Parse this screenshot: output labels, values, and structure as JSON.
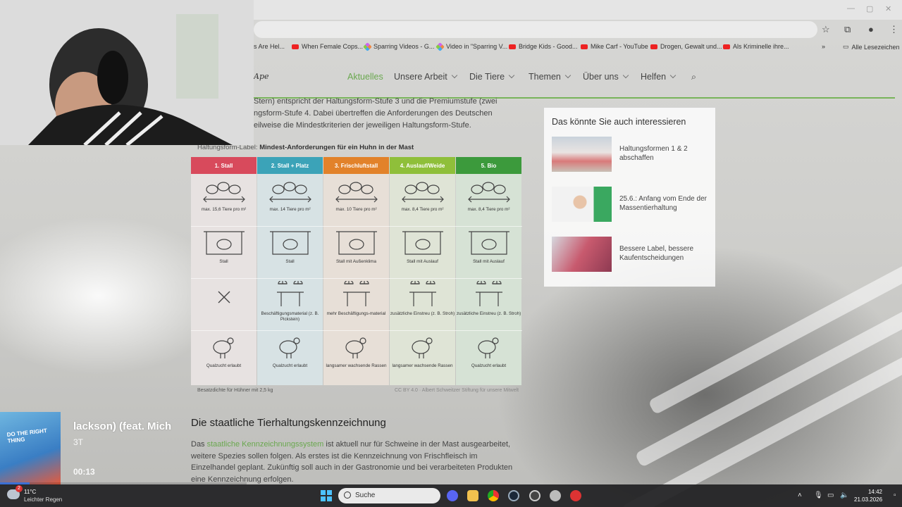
{
  "browser": {
    "bookmarks": [
      {
        "label": "s Are Hel...",
        "icon": "none"
      },
      {
        "label": "When Female Cops...",
        "icon": "youtube-icon"
      },
      {
        "label": "Sparring Videos - G...",
        "icon": "gemini-icon"
      },
      {
        "label": "Video in \"Sparring V...",
        "icon": "gemini-icon"
      },
      {
        "label": "Bridge Kids - Good...",
        "icon": "youtube-icon"
      },
      {
        "label": "Mike Carf - YouTube",
        "icon": "youtube-icon"
      },
      {
        "label": "Drogen, Gewalt und...",
        "icon": "youtube-icon"
      },
      {
        "label": "Als Kriminelle ihre...",
        "icon": "youtube-icon"
      }
    ],
    "bookmarks_more": "»",
    "all_bookmarks": "Alle Lesezeichen"
  },
  "site": {
    "logo": "Ape",
    "nav": [
      {
        "label": "Aktuelles",
        "active": true
      },
      {
        "label": "Unsere Arbeit",
        "dropdown": true
      },
      {
        "label": "Die Tiere",
        "dropdown": true
      },
      {
        "label": "Themen",
        "dropdown": true
      },
      {
        "label": "Über uns",
        "dropdown": true
      },
      {
        "label": "Helfen",
        "dropdown": true
      }
    ]
  },
  "article": {
    "intro": [
      "Stern) entspricht der Haltungsform-Stufe 3 und die Premiumstufe (zwei",
      "ngsform-Stufe 4. Dabei übertreffen die Anforderungen des Deutschen",
      "eilweise die Mindestkriterien der jeweiligen Haltungsform-Stufe."
    ],
    "figure_caption_prefix": "Haltungsform-Label: ",
    "figure_caption_bold": "Mindest-Anforderungen für ein Huhn in der Mast",
    "columns": [
      {
        "head": "1. Stall",
        "color": "#d84a5c",
        "bg": "#e7e2e1",
        "rows": [
          "max. 15,6 Tiere pro m²",
          "Stall",
          "",
          "Qualzucht erlaubt"
        ]
      },
      {
        "head": "2. Stall + Platz",
        "color": "#3ba3b8",
        "bg": "#d7e2e4",
        "rows": [
          "max. 14 Tiere pro m²",
          "Stall",
          "Beschäftigungsmaterial (z. B. Pickstein)",
          "Qualzucht erlaubt"
        ]
      },
      {
        "head": "3. Frischluftstall",
        "color": "#e2822a",
        "bg": "#e7dfd7",
        "rows": [
          "max. 10 Tiere pro m²",
          "Stall mit Außenklima",
          "mehr Beschäftigungs-material",
          "langsamer wachsende Rassen"
        ]
      },
      {
        "head": "4. Auslauf/Weide",
        "color": "#8fbf3a",
        "bg": "#dfe4d6",
        "rows": [
          "max. 8,4 Tiere pro m²",
          "Stall mit Auslauf",
          "zusätzliche Einstreu (z. B. Stroh)",
          "langsamer wachsende Rassen"
        ]
      },
      {
        "head": "5. Bio",
        "color": "#3c9a3c",
        "bg": "#d6e2d5",
        "rows": [
          "max. 8,4 Tiere pro m²",
          "Stall mit Auslauf",
          "zusätzliche Einstreu (z. B. Stroh)",
          "Qualzucht erlaubt"
        ]
      }
    ],
    "figure_footnote": "Besatzdichte für Hühner mit 2,5 kg",
    "figure_credit": "CC BY 4.0 · Albert Schweitzer Stiftung für unsere Mitwelt",
    "heading": "Die staatliche Tierhaltungskennzeichnung",
    "para_lead": "Das ",
    "para_link": "staatliche Kennzeichnungssystem",
    "para_rest": " ist aktuell nur für Schweine in der Mast ausgearbeitet, weitere Spezies sollen folgen. Als erstes ist die Kennzeichnung von Frischfleisch im Einzelhandel geplant. Zukünftig soll auch in der Gastronomie und bei verarbeiteten Produkten eine Kennzeichnung erfolgen."
  },
  "sidebar": {
    "title": "Das könnte Sie auch interessieren",
    "items": [
      {
        "text": "Haltungsformen 1 & 2 abschaffen"
      },
      {
        "text": "25.6.: Anfang vom Ende der Massentierhaltung"
      },
      {
        "text": "Bessere Label, bessere Kaufentscheidungen"
      }
    ]
  },
  "music": {
    "cover_text": "DO THE RIGHT THING",
    "title": "lackson) (feat. Mich",
    "subtitle": "3T",
    "time": "00:13",
    "progress": 0.12
  },
  "taskbar": {
    "weather_temp": "11°C",
    "weather_desc": "Leichter Regen",
    "weather_badge": "2",
    "search": "Suche",
    "time": "14:42",
    "date": "21.03.2026"
  }
}
